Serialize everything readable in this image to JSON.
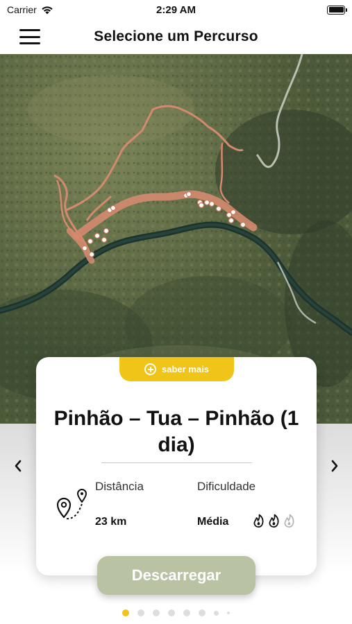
{
  "status_bar": {
    "carrier": "Carrier",
    "time": "2:29 AM"
  },
  "header": {
    "title": "Selecione um Percurso",
    "menu_icon": "hamburger-menu-icon"
  },
  "map": {
    "type": "satellite",
    "route_color": "#d48a6f",
    "river_color": "#1f3a32"
  },
  "card": {
    "more_button": "saber mais",
    "route_name": "Pinhão – Tua – Pinhão (1 dia)",
    "distance_label": "Distância",
    "distance_value": "23 km",
    "difficulty_label": "Dificuldade",
    "difficulty_value": "Média",
    "difficulty_level": 2,
    "difficulty_max": 3,
    "accent": "#f0c419"
  },
  "actions": {
    "download_label": "Descarregar",
    "download_color": "#b9c2a2"
  },
  "pagination": {
    "total": 8,
    "active": 0
  }
}
